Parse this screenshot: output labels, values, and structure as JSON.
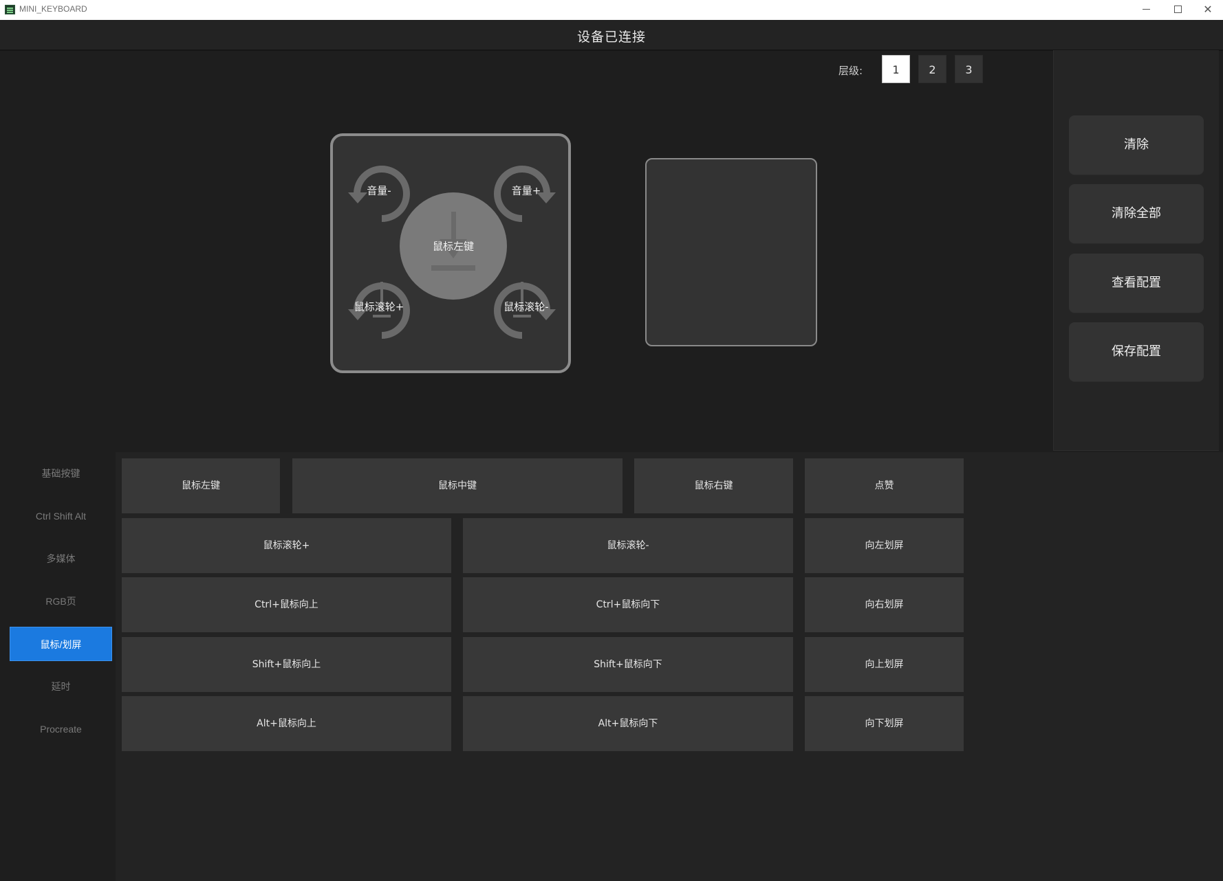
{
  "window": {
    "title": "MINI_KEYBOARD",
    "minimize": "",
    "maximize": "",
    "close": "✕"
  },
  "header": {
    "status": "设备已连接"
  },
  "layer": {
    "label": "层级:",
    "options": [
      "1",
      "2",
      "3"
    ],
    "selected": "1"
  },
  "knob": {
    "top_left": "音量-",
    "top_right": "音量+",
    "center": "鼠标左键",
    "bottom_left": "鼠标滚轮+",
    "bottom_right": "鼠标滚轮-"
  },
  "actions": {
    "clear": "清除",
    "clear_all": "清除全部",
    "view_config": "查看配置",
    "save_config": "保存配置"
  },
  "nav": {
    "items": [
      "基础按键",
      "Ctrl Shift Alt",
      "多媒体",
      "RGB页",
      "鼠标/划屏",
      "延时",
      "Procreate"
    ],
    "active": "鼠标/划屏"
  },
  "functions": {
    "row1": [
      "鼠标左键",
      "鼠标中键",
      "鼠标右键",
      "点赞"
    ],
    "row2": [
      "鼠标滚轮+",
      "鼠标滚轮-",
      "向左划屏"
    ],
    "row3": [
      "Ctrl+鼠标向上",
      "Ctrl+鼠标向下",
      "向右划屏"
    ],
    "row4": [
      "Shift+鼠标向上",
      "Shift+鼠标向下",
      "向上划屏"
    ],
    "row5": [
      "Alt+鼠标向上",
      "Alt+鼠标向下",
      "向下划屏"
    ]
  },
  "colors": {
    "accent": "#1b7ae0",
    "background": "#1e1e1e",
    "button": "#383838"
  }
}
